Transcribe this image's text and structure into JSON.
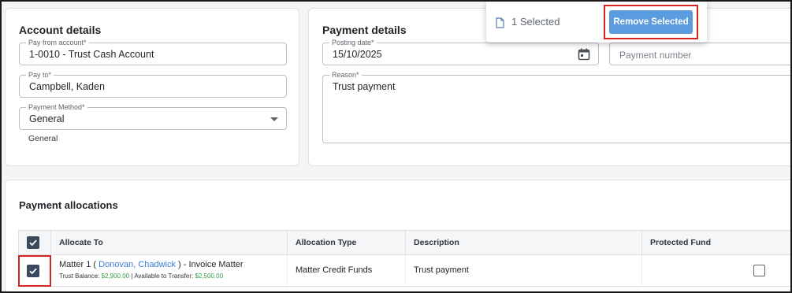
{
  "account": {
    "title": "Account details",
    "pay_from": {
      "label": "Pay from account*",
      "value": "1-0010 - Trust Cash Account"
    },
    "pay_to": {
      "label": "Pay to*",
      "value": "Campbell, Kaden"
    },
    "method": {
      "label": "Payment Method*",
      "value": "General",
      "helper": "General"
    }
  },
  "payment": {
    "title": "Payment details",
    "posting_date": {
      "label": "Posting date*",
      "value": "15/10/2025"
    },
    "payment_number": {
      "placeholder": "Payment number"
    },
    "reason": {
      "label": "Reason*",
      "value": "Trust payment"
    }
  },
  "selection_bar": {
    "count_text": "1 Selected",
    "remove_label": "Remove Selected"
  },
  "allocations": {
    "title": "Payment allocations",
    "columns": [
      "Allocate To",
      "Allocation Type",
      "Description",
      "Protected Fund"
    ],
    "rows": [
      {
        "matter_prefix": "Matter 1 ( ",
        "matter_link": "Donovan, Chadwick",
        "matter_suffix": " ) - Invoice Matter",
        "trust_balance_label": "Trust Balance: ",
        "trust_balance": "$2,900.00",
        "separator": " | ",
        "available_label": "Available to Transfer: ",
        "available": "$2,500.00",
        "allocation_type": "Matter Credit Funds",
        "description": "Trust payment"
      }
    ]
  },
  "colors": {
    "accent_button": "#5b9be0",
    "highlight_box": "#d62424",
    "checkbox_checked": "#3b4a5c",
    "money_green": "#2f9e44",
    "link_blue": "#3a7bd5"
  },
  "icons": [
    "document-icon",
    "calendar-icon",
    "chevron-down-icon",
    "checkbox-checked-icon"
  ]
}
